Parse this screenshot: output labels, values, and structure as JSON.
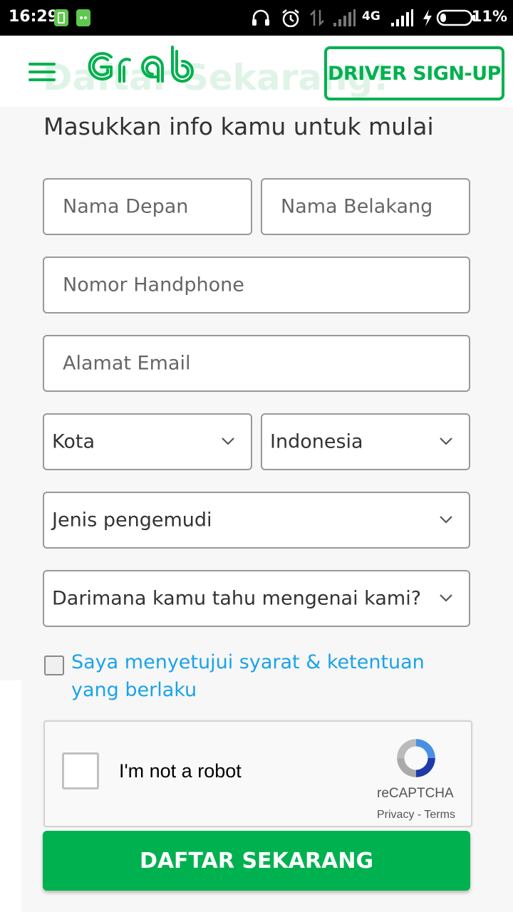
{
  "status_bar": {
    "time": "16:29",
    "network": "4G",
    "battery_pct": "11%"
  },
  "header": {
    "logo_text": "Grab",
    "watermark": "Daftar Sekarang!",
    "driver_signup": "DRIVER SIGN-UP"
  },
  "form": {
    "title": "Masukkan info kamu untuk mulai",
    "first_name_placeholder": "Nama Depan",
    "last_name_placeholder": "Nama Belakang",
    "phone_placeholder": "Nomor Handphone",
    "email_placeholder": "Alamat Email",
    "city_select": "Kota",
    "country_select": "Indonesia",
    "driver_type_select": "Jenis pengemudi",
    "source_select": "Darimana kamu tahu mengenai kami?",
    "terms_text": "Saya menyetujui syarat & ketentuan yang berlaku",
    "submit": "DAFTAR SEKARANG"
  },
  "recaptcha": {
    "label": "I'm not a robot",
    "brand": "reCAPTCHA",
    "links": "Privacy - Terms"
  },
  "colors": {
    "brand_green": "#00b14f",
    "link_blue": "#1aa3e8"
  }
}
